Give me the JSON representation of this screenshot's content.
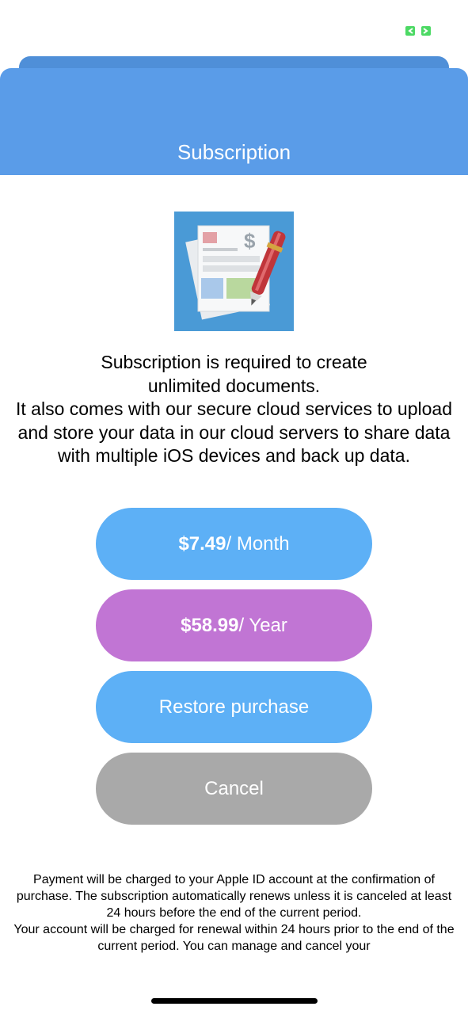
{
  "status_bar": {
    "indicator_icon": "screen-record-icon",
    "indicator_color": "#4cd964"
  },
  "header": {
    "title": "Subscription",
    "background": "#5a9ce8"
  },
  "app_icon": {
    "icon": "invoice-document-pen-icon"
  },
  "description": {
    "text": "Subscription is required to create\nunlimited documents.\nIt also comes with our secure cloud services to upload and store your data in our cloud servers to share data with multiple iOS devices and back up data."
  },
  "plans": {
    "monthly": {
      "price": "$7.49",
      "period": " / Month",
      "color": "#5db0f6"
    },
    "yearly": {
      "price": "$58.99",
      "period": " / Year",
      "color": "#c175d4"
    }
  },
  "actions": {
    "restore_label": "Restore purchase",
    "cancel_label": "Cancel"
  },
  "legal": {
    "paragraph1": "Payment will be charged to your Apple ID account at the confirmation of purchase. The subscription automatically renews unless it is canceled at least 24 hours before the end of the current period.",
    "paragraph2": "Your account will be charged for renewal within 24 hours prior to the end of the current period. You can manage and cancel your"
  }
}
